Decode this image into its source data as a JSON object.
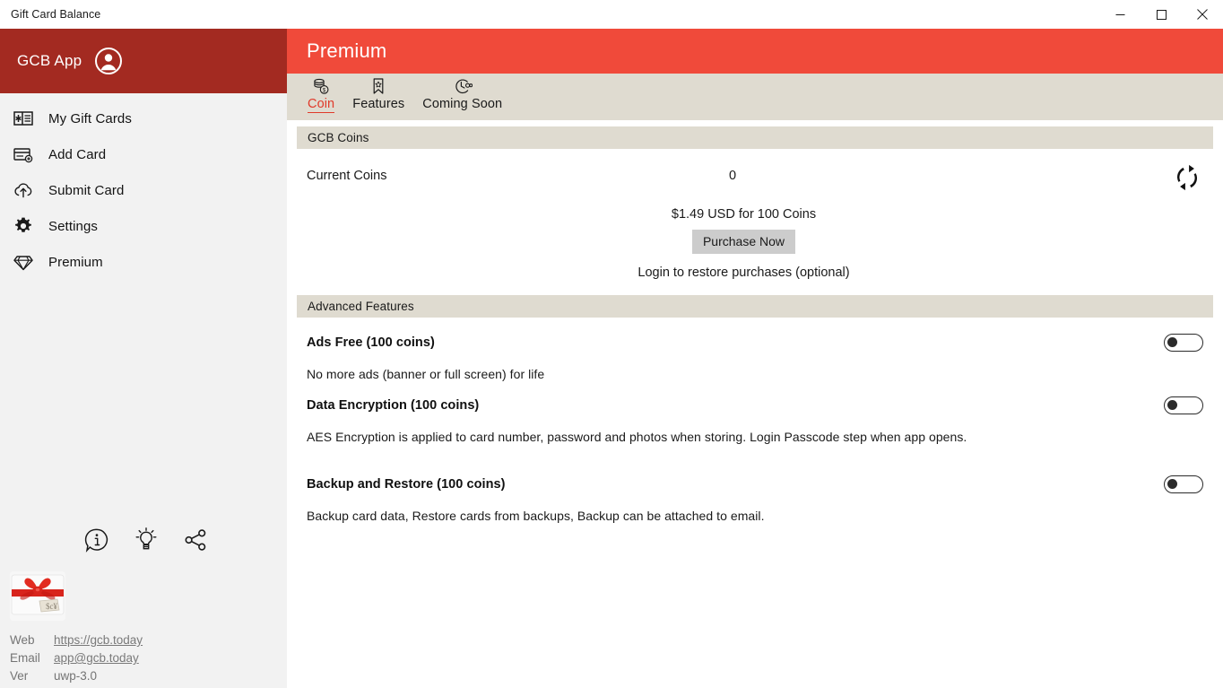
{
  "window": {
    "title": "Gift Card Balance",
    "controls": [
      {
        "name": "minimize",
        "label": "—"
      },
      {
        "name": "maximize",
        "label": "☐"
      },
      {
        "name": "close",
        "label": "✕"
      }
    ]
  },
  "sidebar": {
    "brand": "GCB App",
    "account_icon": "account-circle-icon",
    "items": [
      {
        "label": "My Gift Cards",
        "icon": "gift-card-icon"
      },
      {
        "label": "Add Card",
        "icon": "credit-card-add-icon"
      },
      {
        "label": "Submit Card",
        "icon": "cloud-upload-icon"
      },
      {
        "label": "Settings",
        "icon": "gear-icon"
      },
      {
        "label": "Premium",
        "icon": "diamond-icon"
      }
    ],
    "action_icons": [
      {
        "name": "info-bubble-icon"
      },
      {
        "name": "lightbulb-icon"
      },
      {
        "name": "share-icon"
      }
    ],
    "logo": "gift-card-bow-logo",
    "footer": [
      {
        "key": "Web",
        "value": "https://gcb.today",
        "link": true
      },
      {
        "key": "Email",
        "value": "app@gcb.today",
        "link": true
      },
      {
        "key": "Ver",
        "value": "uwp-3.0",
        "link": false
      }
    ]
  },
  "main": {
    "header_title": "Premium",
    "tabs": [
      {
        "label": "Coin",
        "icon": "coin-stack-icon",
        "selected": true
      },
      {
        "label": "Features",
        "icon": "bookmark-star-icon",
        "selected": false
      },
      {
        "label": "Coming Soon",
        "icon": "clock-infinity-icon",
        "selected": false
      }
    ],
    "coins_section": {
      "header": "GCB Coins",
      "current_coins_label": "Current Coins",
      "current_coins_value": "0",
      "refresh_icon": "refresh-icon",
      "price_text": "$1.49 USD for 100 Coins",
      "purchase_button": "Purchase Now",
      "restore_text": "Login to restore purchases (optional)"
    },
    "features_section": {
      "header": "Advanced Features",
      "items": [
        {
          "title": "Ads Free (100 coins)",
          "desc": "No more ads (banner or full screen) for life",
          "toggle_on": false
        },
        {
          "title": "Data Encryption (100 coins)",
          "desc": "AES Encryption is applied to card number, password and photos when storing. Login Passcode step when app opens.",
          "toggle_on": false
        },
        {
          "title": "Backup and Restore (100 coins)",
          "desc": "Backup card data, Restore cards from backups, Backup can be attached to email.",
          "toggle_on": false
        }
      ]
    }
  },
  "colors": {
    "brand_dark_red": "#A32A21",
    "brand_red": "#F04A3A",
    "accent_red": "#E03A2A",
    "beige": "#DFDBD0",
    "sidebar_bg": "#F2F2F2",
    "button_gray": "#CCCCCC"
  }
}
